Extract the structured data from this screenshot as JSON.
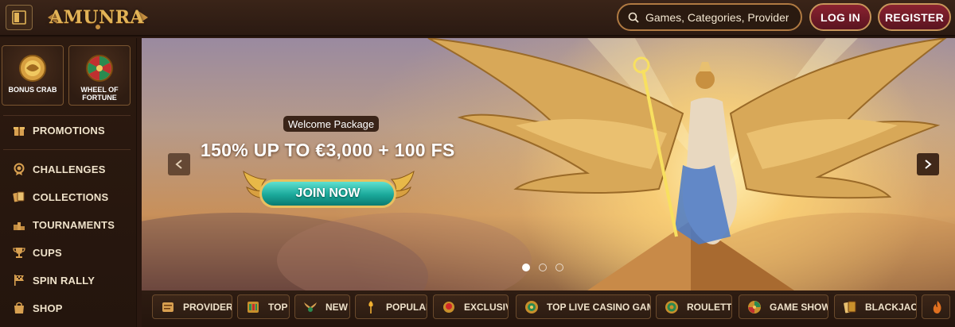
{
  "header": {
    "logo_text": "AMUNRA",
    "search_placeholder": "Games, Categories, Providers",
    "login_label": "LOG IN",
    "register_label": "REGISTER"
  },
  "sidebar": {
    "tiles": [
      {
        "label": "BONUS CRAB",
        "icon": "crab-coin-icon"
      },
      {
        "label": "WHEEL OF FORTUNE",
        "icon": "wheel-icon"
      }
    ],
    "items": [
      {
        "label": "PROMOTIONS",
        "icon": "gift-icon"
      },
      {
        "label": "CHALLENGES",
        "icon": "medal-icon"
      },
      {
        "label": "COLLECTIONS",
        "icon": "cards-icon"
      },
      {
        "label": "TOURNAMENTS",
        "icon": "podium-icon"
      },
      {
        "label": "CUPS",
        "icon": "trophy-icon"
      },
      {
        "label": "SPIN RALLY",
        "icon": "flag-icon"
      },
      {
        "label": "SHOP",
        "icon": "shopping-bag-icon"
      }
    ]
  },
  "hero": {
    "badge": "Welcome Package",
    "offer": "150% UP TO €3,000 + 100 FS",
    "cta_label": "JOIN NOW",
    "slide_count": 3,
    "active_slide": 1
  },
  "categories": [
    {
      "label": "PROVIDERS",
      "icon": "scroll-icon"
    },
    {
      "label": "TOP",
      "icon": "slot-icon"
    },
    {
      "label": "NEW",
      "icon": "winged-icon"
    },
    {
      "label": "POPULAR",
      "icon": "torch-icon"
    },
    {
      "label": "EXCLUSIVE",
      "icon": "gem-icon"
    },
    {
      "label": "TOP LIVE CASINO GAMES",
      "icon": "chip-icon"
    },
    {
      "label": "ROULETTE",
      "icon": "roulette-icon"
    },
    {
      "label": "GAME SHOWS",
      "icon": "wheel-icon"
    },
    {
      "label": "BLACKJACK",
      "icon": "cards-icon"
    },
    {
      "label": "",
      "icon": "fire-icon"
    }
  ],
  "colors": {
    "accent_gold": "#e2b457",
    "button_red": "#8a2230",
    "cta_teal": "#1aa89a",
    "background": "#2a1810"
  }
}
